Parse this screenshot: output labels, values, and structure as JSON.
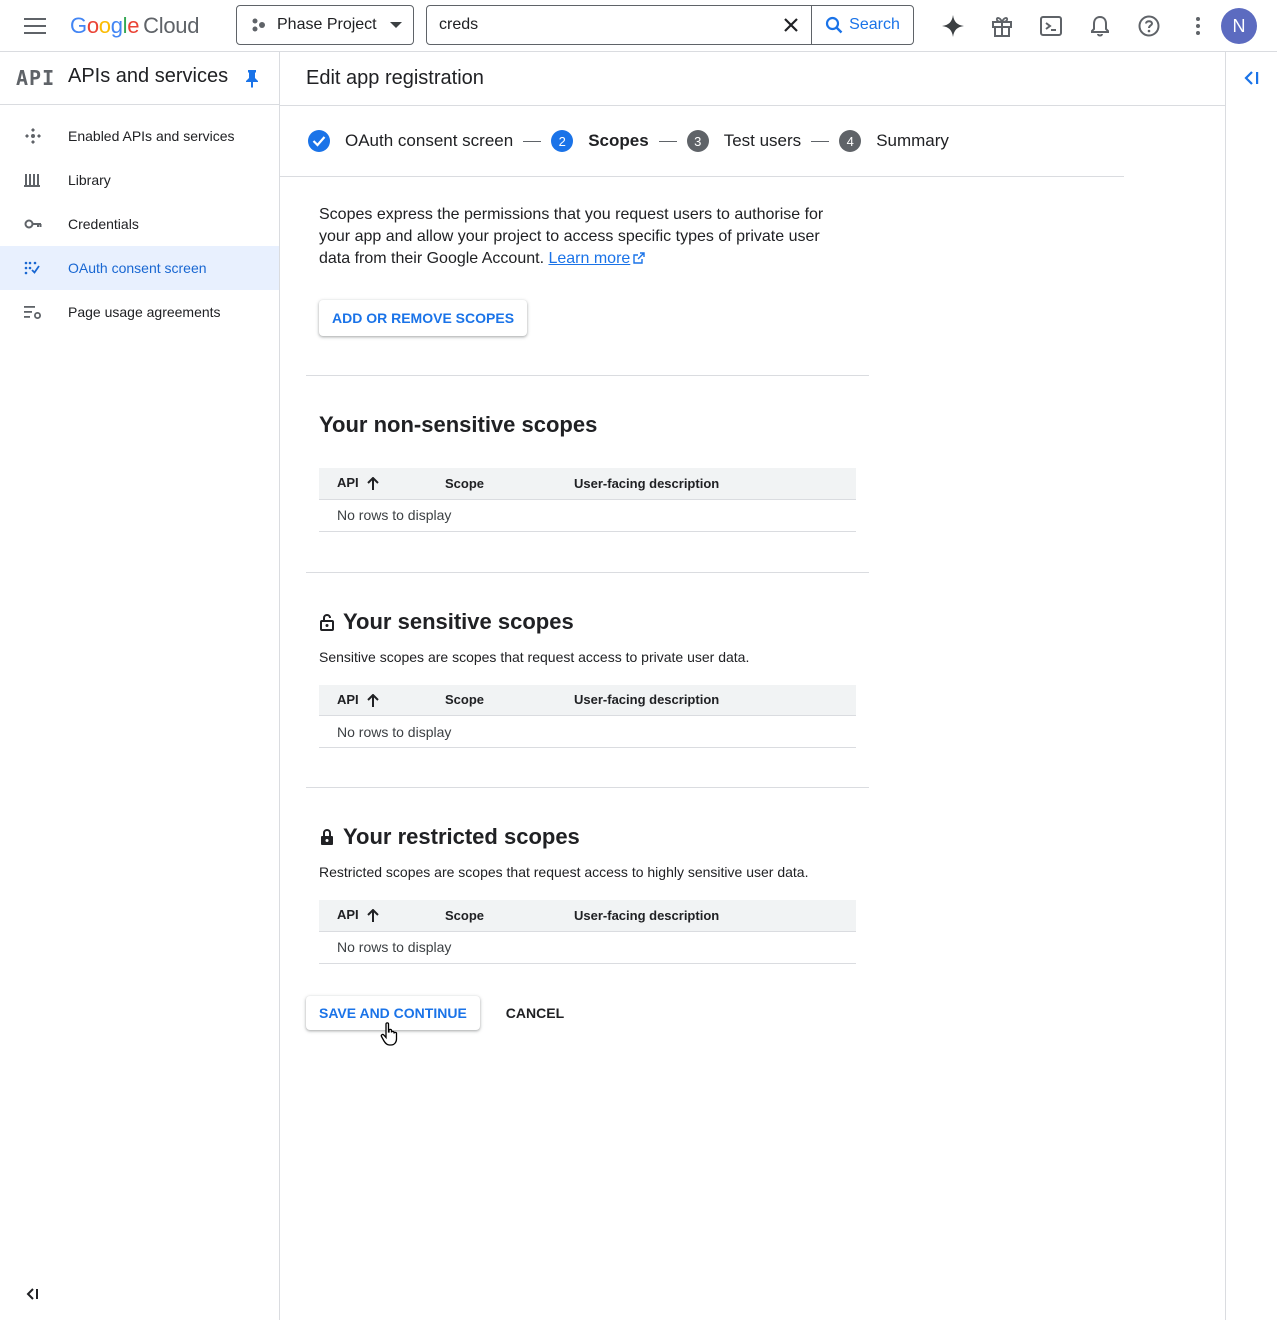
{
  "topbar": {
    "logo_google": [
      "G",
      "o",
      "o",
      "g",
      "l",
      "e"
    ],
    "logo_cloud": "Cloud",
    "project_name": "Phase Project",
    "search_value": "creds",
    "search_label": "Search",
    "avatar_letter": "N"
  },
  "sidebar": {
    "api_logo": "API",
    "title": "APIs and services",
    "items": [
      {
        "label": "Enabled APIs and services",
        "icon": "apis-icon",
        "active": false
      },
      {
        "label": "Library",
        "icon": "library-icon",
        "active": false
      },
      {
        "label": "Credentials",
        "icon": "key-icon",
        "active": false
      },
      {
        "label": "OAuth consent screen",
        "icon": "consent-icon",
        "active": true
      },
      {
        "label": "Page usage agreements",
        "icon": "settings-list-icon",
        "active": false
      }
    ]
  },
  "page": {
    "title": "Edit app registration",
    "steps": [
      {
        "label": "OAuth consent screen",
        "state": "done"
      },
      {
        "num": "2",
        "label": "Scopes",
        "state": "current"
      },
      {
        "num": "3",
        "label": "Test users",
        "state": "todo"
      },
      {
        "num": "4",
        "label": "Summary",
        "state": "todo"
      }
    ],
    "intro": "Scopes express the permissions that you request users to authorise for your app and allow your project to access specific types of private user data from their Google Account.",
    "learn_more": "Learn more",
    "add_scopes_button": "ADD OR REMOVE SCOPES",
    "sections": [
      {
        "title": "Your non-sensitive scopes",
        "description": "",
        "icon": ""
      },
      {
        "title": "Your sensitive scopes",
        "description": "Sensitive scopes are scopes that request access to private user data.",
        "icon": "lock-open-icon"
      },
      {
        "title": "Your restricted scopes",
        "description": "Restricted scopes are scopes that request access to highly sensitive user data.",
        "icon": "lock-icon"
      }
    ],
    "table_headers": {
      "api": "API",
      "scope": "Scope",
      "description": "User-facing description"
    },
    "empty_text": "No rows to display",
    "save_button": "SAVE AND CONTINUE",
    "cancel_button": "CANCEL"
  },
  "colors": {
    "accent": "#1a73e8",
    "active_bg": "#e8f0fe",
    "divider": "#dadce0",
    "avatar": "#5c6bc0"
  }
}
